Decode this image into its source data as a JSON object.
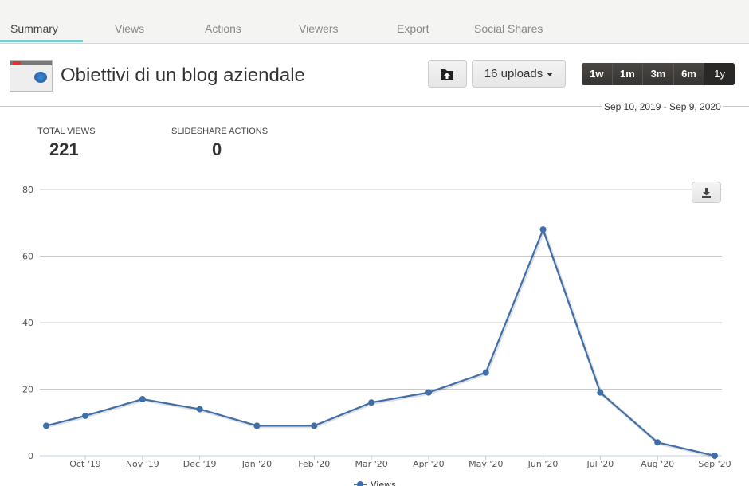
{
  "tabs": [
    {
      "label": "Summary",
      "active": true
    },
    {
      "label": "Views",
      "active": false
    },
    {
      "label": "Actions",
      "active": false
    },
    {
      "label": "Viewers",
      "active": false
    },
    {
      "label": "Export",
      "active": false
    },
    {
      "label": "Social Shares",
      "active": false
    }
  ],
  "header": {
    "title": "Obiettivi di un blog aziendale",
    "upload_icon": "folder-upload-icon",
    "uploads_label": "16 uploads",
    "range_buttons": [
      {
        "label": "1w",
        "active": false
      },
      {
        "label": "1m",
        "active": false
      },
      {
        "label": "3m",
        "active": false
      },
      {
        "label": "6m",
        "active": false
      },
      {
        "label": "1y",
        "active": true
      }
    ],
    "date_range": "Sep 10, 2019 - Sep 9, 2020"
  },
  "stats": {
    "total_views_label": "TOTAL VIEWS",
    "total_views": "221",
    "actions_label": "SLIDESHARE ACTIONS",
    "actions": "0"
  },
  "download_icon": "download-icon",
  "colors": {
    "accent": "#7ccfd1",
    "series": "#3f6fa6"
  },
  "chart_data": {
    "type": "line",
    "title": "",
    "xlabel": "",
    "ylabel": "",
    "ylim": [
      0,
      80
    ],
    "yticks": [
      0,
      20,
      40,
      60,
      80
    ],
    "grid": true,
    "legend": "bottom-center",
    "x_tick_labels": [
      "Oct '19",
      "Nov '19",
      "Dec '19",
      "Jan '20",
      "Feb '20",
      "Mar '20",
      "Apr '20",
      "May '20",
      "Jun '20",
      "Jul '20",
      "Aug '20",
      "Sep '20"
    ],
    "x": [
      "Sep 10 '19",
      "Oct '19",
      "Nov '19",
      "Dec '19",
      "Jan '20",
      "Feb '20",
      "Mar '20",
      "Apr '20",
      "May '20",
      "Jun '20",
      "Jul '20",
      "Aug '20",
      "Sep '20"
    ],
    "series": [
      {
        "name": "Views",
        "values": [
          9,
          12,
          17,
          14,
          9,
          9,
          16,
          19,
          25,
          68,
          19,
          4,
          0
        ]
      }
    ]
  }
}
